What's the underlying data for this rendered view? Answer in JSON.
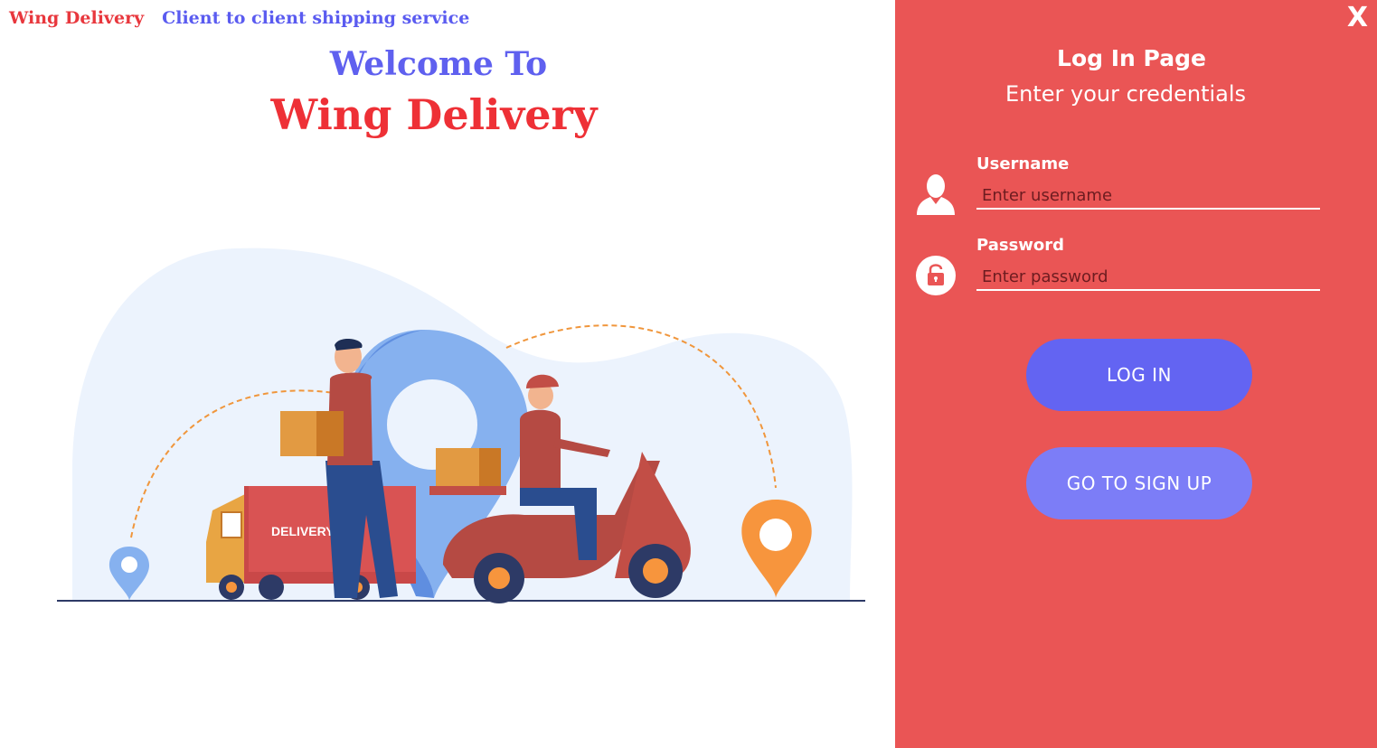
{
  "header": {
    "brand": "Wing Delivery",
    "tagline": "Client to client shipping service"
  },
  "hero": {
    "welcome": "Welcome To",
    "title": "Wing Delivery",
    "truck_label": "DELIVERY"
  },
  "panel": {
    "close_label": "X",
    "title": "Log In Page",
    "subtitle": "Enter your credentials",
    "username": {
      "label": "Username",
      "placeholder": "Enter username",
      "value": "",
      "icon": "user-icon"
    },
    "password": {
      "label": "Password",
      "placeholder": "Enter password",
      "value": "",
      "icon": "lock-icon"
    },
    "login_label": "LOG IN",
    "signup_label": "GO TO SIGN UP"
  },
  "colors": {
    "panel_bg": "#ea5555",
    "brand_red": "#ee3036",
    "accent_blue": "#6364f2",
    "accent_blue_light": "#7c7df7"
  }
}
